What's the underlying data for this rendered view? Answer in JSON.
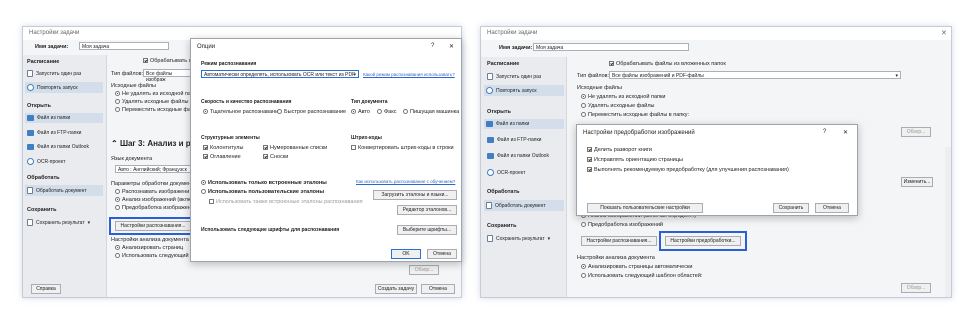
{
  "left": {
    "window_title": "Настройки задачи",
    "task_name_label": "Имя задачи:",
    "task_name_value": "Моя задача",
    "sidebar": {
      "schedule_heading": "Расписание",
      "run_once": "Запустить один раз",
      "repeat_run": "Повторять запуск",
      "open_heading": "Открыть",
      "file_folder": "Файл из папки",
      "file_ftp": "Файл из FTP-папки",
      "file_outlook": "Файл из папки Outlook",
      "ocr_project": "OCR-проект",
      "process_heading": "Обработать",
      "process_doc": "Обработать документ",
      "save_heading": "Сохранить",
      "save_result": "Сохранить результат"
    },
    "process_sub": "Обрабатывать ф",
    "file_type_label": "Тип файлов:",
    "file_type_value": "Все файлы изображ",
    "source_files_label": "Исходные файлы",
    "opt_keep": "Не удалять из исходной папки",
    "opt_delete": "Удалять исходные файлы",
    "opt_move": "Переместить исходные файлы",
    "step3": "Шаг 3: Анализ и расп",
    "doc_lang_label": "Язык документа",
    "doc_lang_value": "Авто : Английский; Французск",
    "params_label": "Параметры обработки документа",
    "param_recognize": "Распознавать изображени",
    "param_analyze": "Анализ изображений (включ",
    "param_preprocess": "Предобработка изображени",
    "recog_settings_btn": "Настройки распознавания...",
    "analysis_label": "Настройки анализа документа",
    "analysis_auto": "Анализировать страниц",
    "analysis_template": "Использовать следующий ша",
    "browse_btn": "Обзор...",
    "help_btn": "Справка",
    "create_btn": "Создать задачу",
    "cancel_btn": "Отмена"
  },
  "options": {
    "title": "Опции",
    "help": "?",
    "close": "✕",
    "mode_label": "Режим распознавания",
    "mode_value": "Автоматически определять, использовать OCR или текст из PDF",
    "mode_link": "Какой режим распознавания использовать?",
    "speed_label": "Скорость и качество распознавания",
    "speed_thorough": "Тщательное распознавание",
    "speed_fast": "Быстрое распознавание",
    "doctype_label": "Тип документа",
    "doctype_auto": "Авто",
    "doctype_fax": "Факс",
    "doctype_typewriter": "Пишущая машинка",
    "struct_label": "Структурные элементы",
    "struct_headers": "Колонтитулы",
    "struct_numbered": "Нумерованные списки",
    "struct_toc": "Оглавление",
    "struct_footnotes": "Сноски",
    "barcode_label": "Штрих-коды",
    "barcode_convert": "Конвертировать штрих-коды в строки",
    "patterns_builtin": "Использовать только встроенные эталоны",
    "patterns_user": "Использовать пользовательские эталоны",
    "patterns_also": "Использовать также встроенные эталоны распознавания",
    "patterns_link": "Как использовать распознавание с обучением?",
    "patterns_lang_btn": "Загрузить эталоны и языки...",
    "patterns_editor_btn": "Редактор эталонов...",
    "fonts_label": "Использовать следующие шрифты для распознавания",
    "fonts_btn": "Выберите шрифты...",
    "ok_btn": "OK",
    "cancel_btn": "Отмена"
  },
  "right": {
    "window_title": "Настройки задачи",
    "close": "✕",
    "task_name_label": "Имя задачи:",
    "task_name_value": "Моя задача",
    "sidebar": {
      "schedule_heading": "Расписание",
      "run_once": "Запустить один раз",
      "repeat_run": "Повторять запуск",
      "open_heading": "Открыть",
      "file_folder": "Файл из папки",
      "file_ftp": "Файл из FTP-папки",
      "file_outlook": "Файл из папки Outlook",
      "ocr_project": "OCR-проект",
      "process_heading": "Обработать",
      "process_doc": "Обработать документ",
      "save_heading": "Сохранить",
      "save_result": "Сохранить результат"
    },
    "process_sub": "Обрабатывать файлы из вложенных папок",
    "file_type_label": "Тип файлов:",
    "file_type_value": "Все файлы изображений и PDF-файлы",
    "source_files_label": "Исходные файлы",
    "opt_keep": "Не удалять из исходной папки",
    "opt_delete": "Удалять исходные файлы",
    "opt_move": "Переместить исходные файлы в папку:",
    "browse_btn": "Обзор...",
    "languages_btn": "Изменить...",
    "param_analyze": "Анализ изображений (включая определ...)",
    "param_preprocess": "Предобработка изображений",
    "recog_settings_btn": "Настройки распознавания...",
    "preprocess_settings_btn": "Настройки предобработки...",
    "analysis_label": "Настройки анализа документа",
    "analysis_auto": "Анализировать страницы автоматически",
    "analysis_template": "Использовать следующий шаблон областей:",
    "browse_btn2": "Обзор..."
  },
  "preproc": {
    "title": "Настройки предобработки изображений",
    "help": "?",
    "close": "✕",
    "split": "Делить разворот книги",
    "orientation": "Исправлять ориентацию страницы",
    "recommended": "Выполнять рекомендуемую предобработку (для улучшения распознавания)",
    "custom_btn": "Показать пользовательские настройки",
    "save_btn": "Сохранить",
    "cancel_btn": "Отмена"
  },
  "colors": {
    "accent": "#2b5fd4",
    "panel_bg": "#f4f5f7",
    "sidebar_bg": "#e9ebef"
  }
}
